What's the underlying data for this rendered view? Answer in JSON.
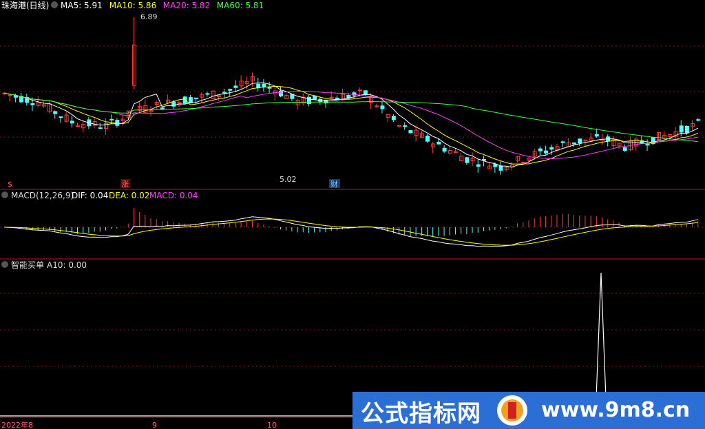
{
  "header": {
    "title": "珠海港(日线)",
    "ma": [
      {
        "label": "MA5: 5.91",
        "color": "#ffffff"
      },
      {
        "label": "MA10: 5.86",
        "color": "#ffff00"
      },
      {
        "label": "MA20: 5.82",
        "color": "#ff40ff"
      },
      {
        "label": "MA60: 5.81",
        "color": "#40ff40"
      }
    ]
  },
  "macd_header": {
    "name": "MACD(12,26,9)",
    "dif": "DIF: 0.04",
    "dea": "DEA: 0.02",
    "macd": "MACD: 0.04"
  },
  "signal_header": {
    "name": "智能买单",
    "value": "A10: 0.00"
  },
  "annotations": {
    "high": "6.89",
    "low": "5.02",
    "event_zhang": "涨",
    "event_cai": "财",
    "event_s": "$"
  },
  "xaxis": {
    "labels": [
      "2022年8",
      "9",
      "10"
    ]
  },
  "watermark": {
    "left": "公式指标网",
    "right": "www.9m8.cn"
  },
  "colors": {
    "up": "#ff3a3a",
    "down": "#54ffff",
    "ma5": "#ffffff",
    "ma10": "#ffff00",
    "ma20": "#ff40ff",
    "ma60": "#40ff40",
    "grid": "#8a1414",
    "divider": "#c01818"
  },
  "chart_data": {
    "type": "candlestick",
    "price_range": [
      4.9,
      6.95
    ],
    "series_candles_count": 124,
    "macd_range": [
      -0.3,
      0.2
    ],
    "signal_peak": 1.0
  }
}
